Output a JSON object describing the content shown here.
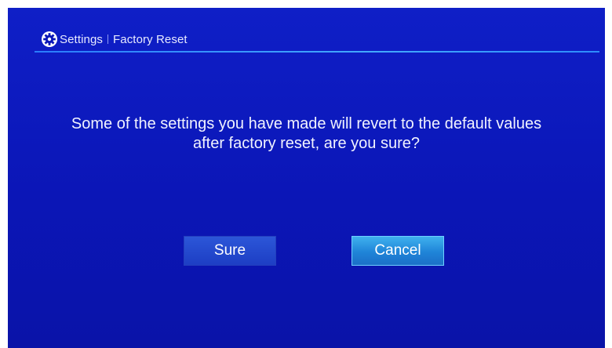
{
  "header": {
    "icon": "gear-icon",
    "breadcrumb_parent": "Settings",
    "breadcrumb_current": "Factory Reset"
  },
  "dialog": {
    "message_line1": "Some of the settings you have made will revert to the default values",
    "message_line2": "after factory reset, are you sure?",
    "confirm_label": "Sure",
    "cancel_label": "Cancel",
    "focused_button": "Cancel"
  },
  "colors": {
    "background": "#0b16b7",
    "rule": "#43a9ff",
    "focused_button": "#1f84d8"
  }
}
